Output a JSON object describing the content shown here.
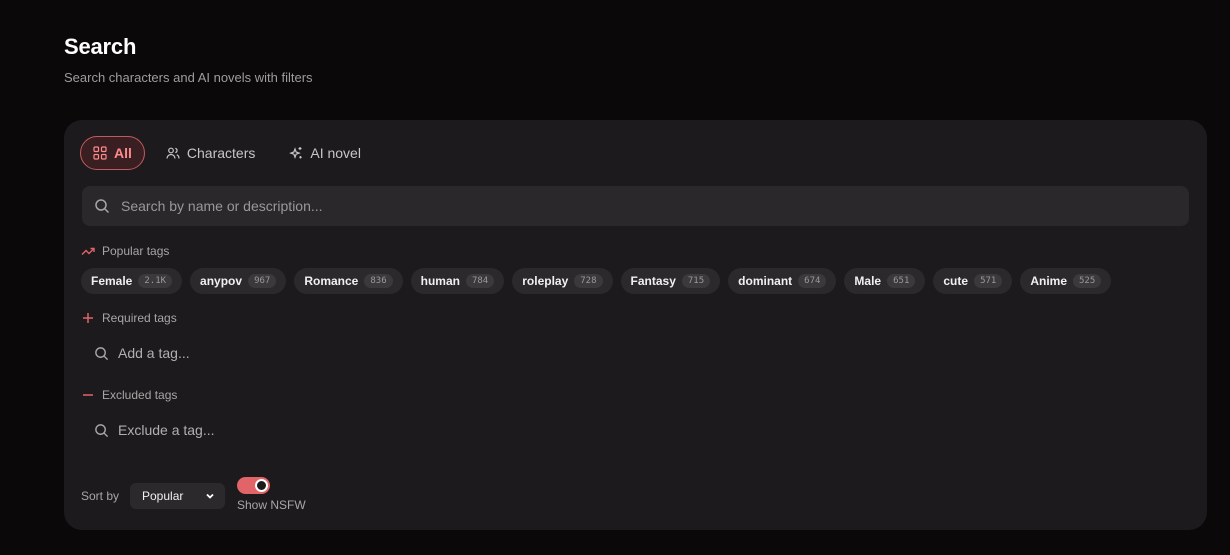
{
  "page": {
    "title": "Search",
    "subtitle": "Search characters and AI novels with filters"
  },
  "tabs": [
    {
      "label": "All",
      "icon": "grid-icon",
      "active": true
    },
    {
      "label": "Characters",
      "icon": "users-icon",
      "active": false
    },
    {
      "label": "AI novel",
      "icon": "sparkles-icon",
      "active": false
    }
  ],
  "search": {
    "placeholder": "Search by name or description...",
    "value": ""
  },
  "popular_tags": {
    "label": "Popular tags",
    "icon": "trending-up-icon",
    "items": [
      {
        "name": "Female",
        "count": "2.1K"
      },
      {
        "name": "anypov",
        "count": "967"
      },
      {
        "name": "Romance",
        "count": "836"
      },
      {
        "name": "human",
        "count": "784"
      },
      {
        "name": "roleplay",
        "count": "728"
      },
      {
        "name": "Fantasy",
        "count": "715"
      },
      {
        "name": "dominant",
        "count": "674"
      },
      {
        "name": "Male",
        "count": "651"
      },
      {
        "name": "cute",
        "count": "571"
      },
      {
        "name": "Anime",
        "count": "525"
      }
    ]
  },
  "required_tags": {
    "label": "Required tags",
    "placeholder": "Add a tag..."
  },
  "excluded_tags": {
    "label": "Excluded tags",
    "placeholder": "Exclude a tag..."
  },
  "sort": {
    "label": "Sort by",
    "selected": "Popular"
  },
  "nsfw": {
    "label": "Show NSFW",
    "enabled": true
  },
  "colors": {
    "accent": "#e06468",
    "panel": "#1c1a1c",
    "background": "#0b0809"
  }
}
